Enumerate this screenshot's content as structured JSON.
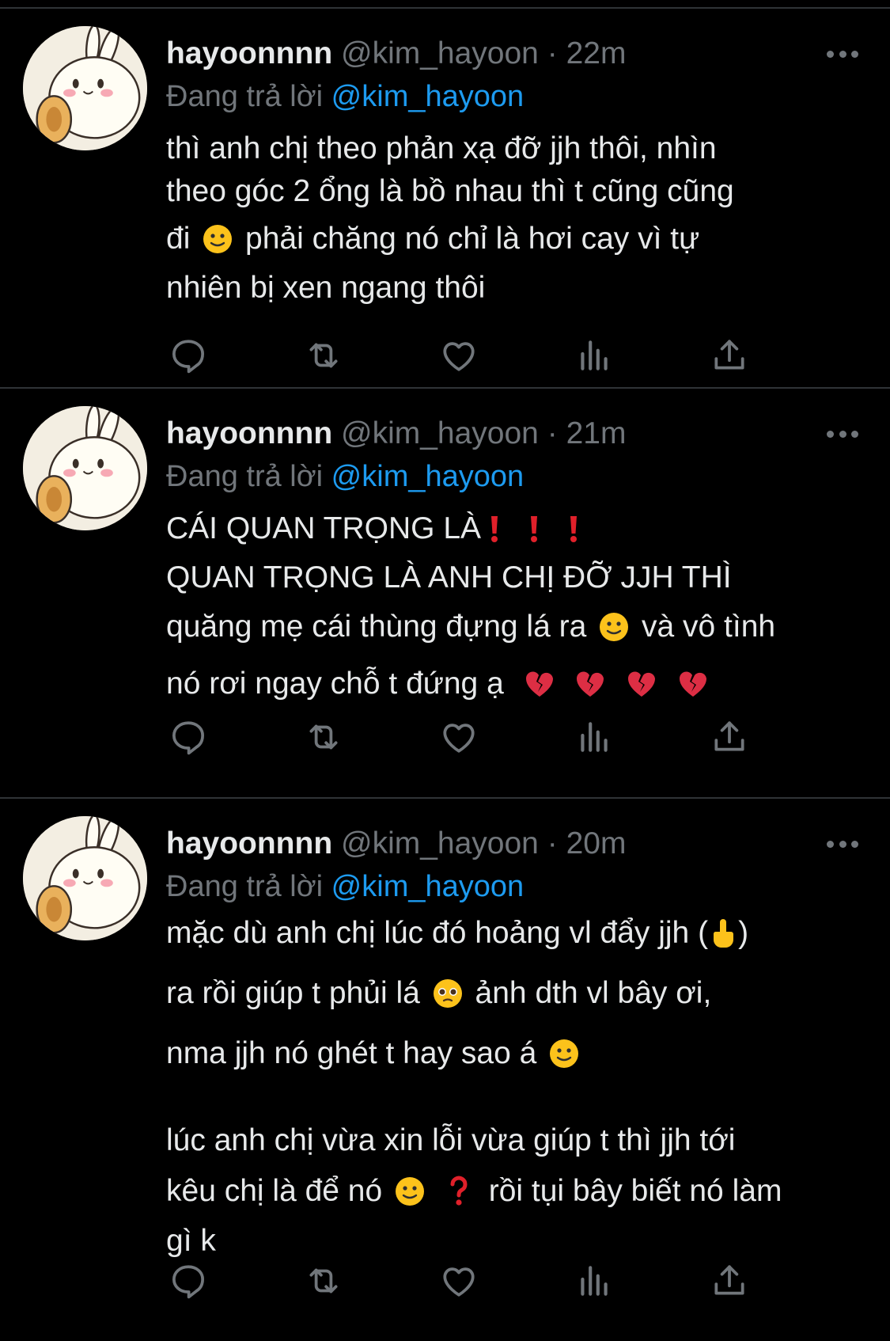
{
  "colors": {
    "background": "#000000",
    "text": "#e7e9ea",
    "muted": "#71767b",
    "link": "#1d9bf0",
    "divider": "#2f3336"
  },
  "tweets": [
    {
      "name": "hayoonnnn",
      "handle": "@kim_hayoon",
      "dot": "·",
      "time": "22m",
      "reply_prefix": "Đang trả lời",
      "reply_handle": "@kim_hayoon",
      "lines": [
        "thì anh chị theo phản xạ đỡ jjh thôi, nhìn",
        "theo góc 2 ổng là bồ nhau thì t cũng cũng",
        "đi",
        "phải chăng nó chỉ là hơi cay vì tự",
        "nhiên bị xen ngang thôi"
      ]
    },
    {
      "name": "hayoonnnn",
      "handle": "@kim_hayoon",
      "dot": "·",
      "time": "21m",
      "reply_prefix": "Đang trả lời",
      "reply_handle": "@kim_hayoon",
      "lines": [
        "CÁI QUAN TRỌNG LÀ",
        "QUAN TRỌNG LÀ ANH CHỊ ĐỠ JJH THÌ",
        "quăng mẹ cái thùng đựng lá ra",
        "và vô tình",
        "nó rơi ngay chỗ t đứng ạ"
      ]
    },
    {
      "name": "hayoonnnn",
      "handle": "@kim_hayoon",
      "dot": "·",
      "time": "20m",
      "reply_prefix": "Đang trả lời",
      "reply_handle": "@kim_hayoon",
      "lines": [
        "mặc dù anh chị lúc đó hoảng vl đẩy jjh (",
        ")",
        "ra rồi giúp t phủi lá",
        "ảnh dth vl bây ơi,",
        "nma jjh nó ghét t hay sao á",
        "lúc anh chị vừa xin lỗi vừa giúp t thì jjh tới",
        "kêu chị là để nó",
        "rồi tụi bây biết nó làm",
        "gì k"
      ]
    }
  ],
  "action_icons": [
    "reply-icon",
    "retweet-icon",
    "like-icon",
    "views-icon",
    "share-icon"
  ]
}
